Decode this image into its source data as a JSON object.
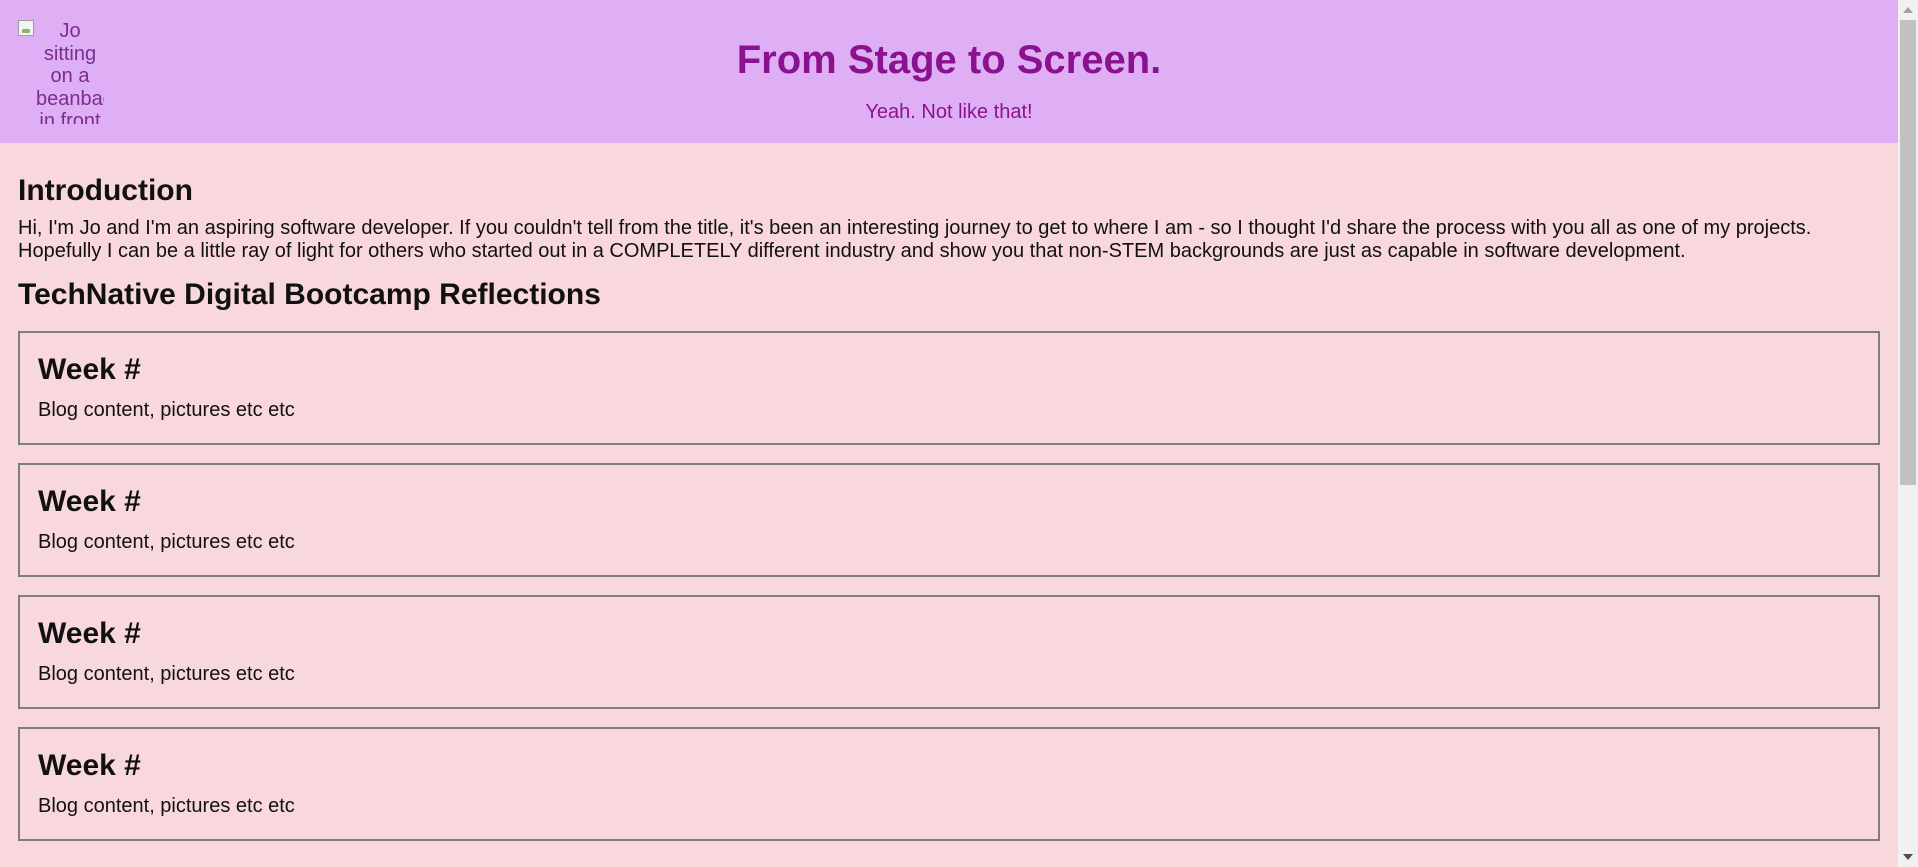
{
  "header": {
    "image_alt": "Jo sitting on a beanbag in front of",
    "title": "From Stage to Screen.",
    "subtitle": "Yeah. Not like that!"
  },
  "intro": {
    "heading": "Introduction",
    "text": "Hi, I'm Jo and I'm an aspiring software developer. If you couldn't tell from the title, it's been an interesting journey to get to where I am - so I thought I'd share the process with you all as one of my projects. Hopefully I can be a little ray of light for others who started out in a COMPLETELY different industry and show you that non-STEM backgrounds are just as capable in software development."
  },
  "bootcamp": {
    "heading": "TechNative Digital Bootcamp Reflections",
    "weeks": [
      {
        "title": "Week #",
        "body": "Blog content, pictures etc etc"
      },
      {
        "title": "Week #",
        "body": "Blog content, pictures etc etc"
      },
      {
        "title": "Week #",
        "body": "Blog content, pictures etc etc"
      },
      {
        "title": "Week #",
        "body": "Blog content, pictures etc etc"
      }
    ]
  },
  "colors": {
    "header_bg": "#dfaff5",
    "page_bg": "#f8d7dd",
    "title_color": "#8b128e"
  }
}
